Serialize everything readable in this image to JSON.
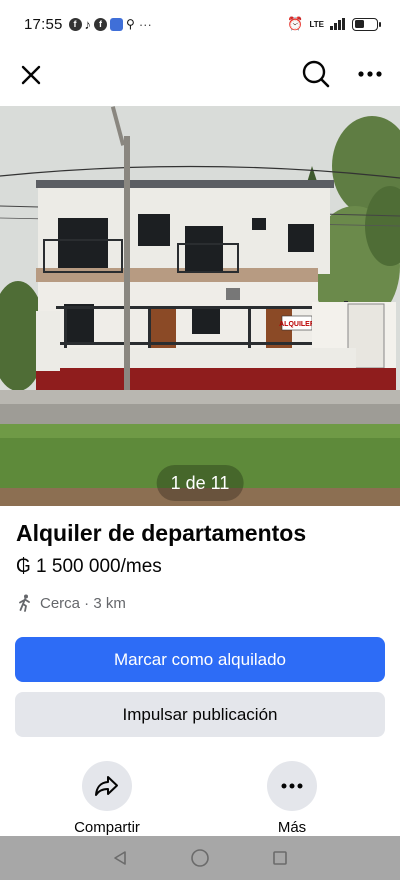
{
  "status_bar": {
    "time": "17:55",
    "notification_icons": [
      "facebook-icon",
      "tiktok-icon",
      "facebook-icon",
      "calendar-app-icon",
      "location-icon"
    ],
    "overflow": "···",
    "network": "LTE",
    "battery_level": 0.45
  },
  "top_bar": {
    "close_icon": "close-icon",
    "search_icon": "search-icon",
    "more_icon": "more-icon"
  },
  "photo": {
    "counter": "1 de 11",
    "sign_text": "ALQUILER"
  },
  "listing": {
    "title": "Alquiler de departamentos",
    "price": "₲ 1 500 000/mes",
    "distance": "Cerca · 3 km"
  },
  "buttons": {
    "primary": "Marcar como alquilado",
    "secondary": "Impulsar publicación"
  },
  "actions": {
    "share": "Compartir",
    "more": "Más"
  },
  "colors": {
    "primary_button": "#2d6cf6",
    "secondary_button": "#e4e6eb",
    "nav_bar": "#a7a7a7",
    "wall_trim": "#8f1d1d"
  }
}
